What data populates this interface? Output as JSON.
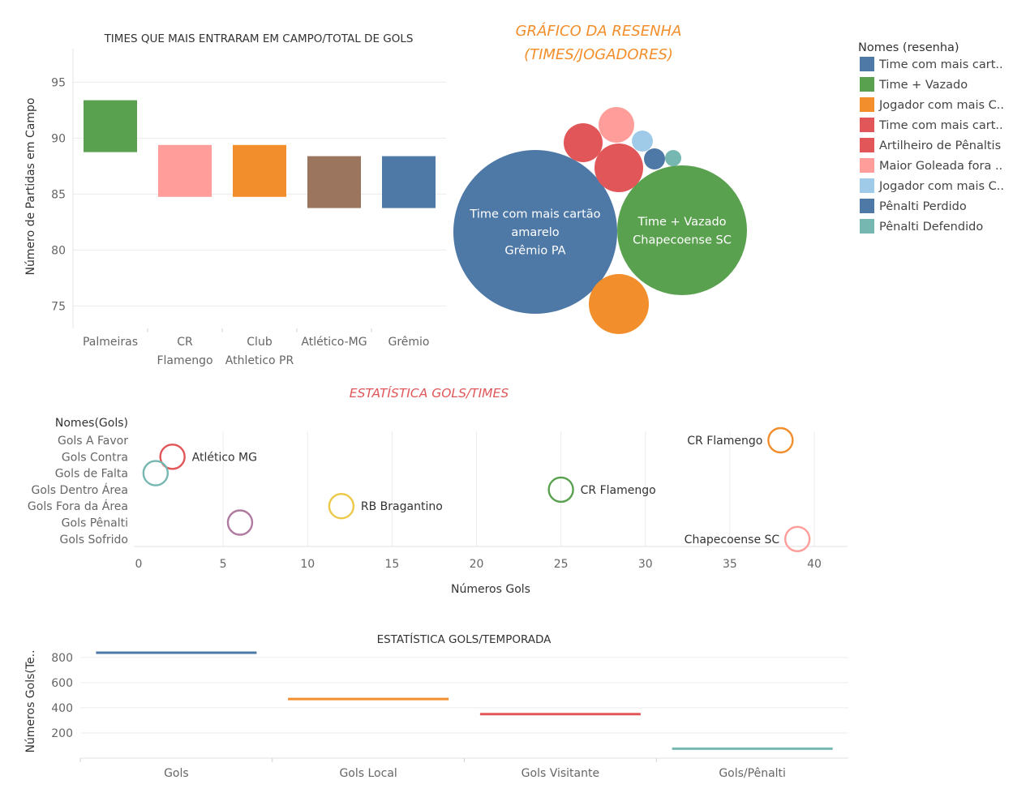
{
  "page": {
    "bubble_title_line1": "GRÁFICO DA RESENHA",
    "bubble_title_line2": "(TIMES/JOGADORES)",
    "scatter_title": "ESTATÍSTICA GOLS/TIMES"
  },
  "legend": {
    "title": "Nomes (resenha)",
    "items": [
      {
        "label": "Time com mais cart..",
        "color": "#4E79A7"
      },
      {
        "label": "Time + Vazado",
        "color": "#59A14F"
      },
      {
        "label": "Jogador com mais C..",
        "color": "#F28E2B"
      },
      {
        "label": "Time com mais cart..",
        "color": "#E15759"
      },
      {
        "label": "Artilheiro de Pênaltis",
        "color": "#E15759"
      },
      {
        "label": "Maior Goleada fora ..",
        "color": "#FF9D9A"
      },
      {
        "label": "Jogador com mais C..",
        "color": "#A0CBE8"
      },
      {
        "label": "Pênalti Perdido",
        "color": "#4E79A7"
      },
      {
        "label": "Pênalti Defendido",
        "color": "#76B7B2"
      }
    ]
  },
  "chart_data": [
    {
      "type": "bar",
      "title": "TIMES QUE MAIS ENTRARAM EM CAMPO/TOTAL DE GOLS",
      "ylabel": "Número de Partidas em Campo",
      "xlabel": "",
      "ylim": [
        73,
        98
      ],
      "yticks": [
        75,
        80,
        85,
        90,
        95
      ],
      "categories": [
        {
          "lines": [
            "Palmeiras"
          ]
        },
        {
          "lines": [
            "CR",
            "Flamengo"
          ]
        },
        {
          "lines": [
            "Club",
            "Athletico PR"
          ]
        },
        {
          "lines": [
            "Atlético-MG"
          ]
        },
        {
          "lines": [
            "Grêmio"
          ]
        }
      ],
      "values": [
        91,
        87,
        87,
        86,
        86
      ],
      "colors": [
        "#59A14F",
        "#FF9D9A",
        "#F28E2B",
        "#9C755F",
        "#4E79A7"
      ]
    },
    {
      "type": "bubble",
      "bubbles": [
        {
          "color": "#4E79A7",
          "label_lines": [
            "Time com mais cartão",
            "amarelo",
            "Grêmio PA"
          ]
        },
        {
          "color": "#59A14F",
          "label_lines": [
            "Time + Vazado",
            "Chapecoense SC"
          ]
        },
        {
          "color": "#F28E2B",
          "label_lines": []
        },
        {
          "color": "#E15759",
          "label_lines": []
        },
        {
          "color": "#E15759",
          "label_lines": []
        },
        {
          "color": "#FF9D9A",
          "label_lines": []
        },
        {
          "color": "#A0CBE8",
          "label_lines": []
        },
        {
          "color": "#4E79A7",
          "label_lines": []
        },
        {
          "color": "#76B7B2",
          "label_lines": []
        }
      ]
    },
    {
      "type": "scatter",
      "title": "ESTATÍSTICA GOLS/TIMES",
      "xlabel": "Números Gols",
      "ylabel": "Nomes(Gols)",
      "xlim": [
        0,
        42
      ],
      "xticks": [
        0,
        5,
        10,
        15,
        20,
        25,
        30,
        35,
        40
      ],
      "categories": [
        "Gols A Favor",
        "Gols Contra",
        "Gols de Falta",
        "Gols Dentro Área",
        "Gols Fora da Área",
        "Gols Pênalti",
        "Gols Sofrido"
      ],
      "points": [
        {
          "category": "Gols A Favor",
          "x": 38,
          "label": "CR Flamengo",
          "color": "#F28E2B",
          "label_side": "left"
        },
        {
          "category": "Gols Contra",
          "x": 2,
          "label": "Atlético MG",
          "color": "#E15759",
          "label_side": "right"
        },
        {
          "category": "Gols de Falta",
          "x": 1,
          "label": "",
          "color": "#76B7B2",
          "label_side": "right"
        },
        {
          "category": "Gols Dentro Área",
          "x": 25,
          "label": "CR Flamengo",
          "color": "#59A14F",
          "label_side": "right"
        },
        {
          "category": "Gols Fora da Área",
          "x": 12,
          "label": "RB Bragantino",
          "color": "#EDC948",
          "label_side": "right"
        },
        {
          "category": "Gols Pênalti",
          "x": 6,
          "label": "",
          "color": "#B07AA1",
          "label_side": "right"
        },
        {
          "category": "Gols Sofrido",
          "x": 39,
          "label": "Chapecoense SC",
          "color": "#FF9D9A",
          "label_side": "left"
        }
      ]
    },
    {
      "type": "bar",
      "title": "ESTATÍSTICA GOLS/TEMPORADA",
      "ylabel": "Números Gols(Te..",
      "xlabel": "",
      "ylim": [
        0,
        870
      ],
      "yticks": [
        200,
        400,
        600,
        800
      ],
      "categories": [
        "Gols",
        "Gols Local",
        "Gols Visitante",
        "Gols/Pênalti"
      ],
      "values": [
        838,
        470,
        350,
        75
      ],
      "colors": [
        "#4E79A7",
        "#F28E2B",
        "#E15759",
        "#76B7B2"
      ]
    }
  ]
}
